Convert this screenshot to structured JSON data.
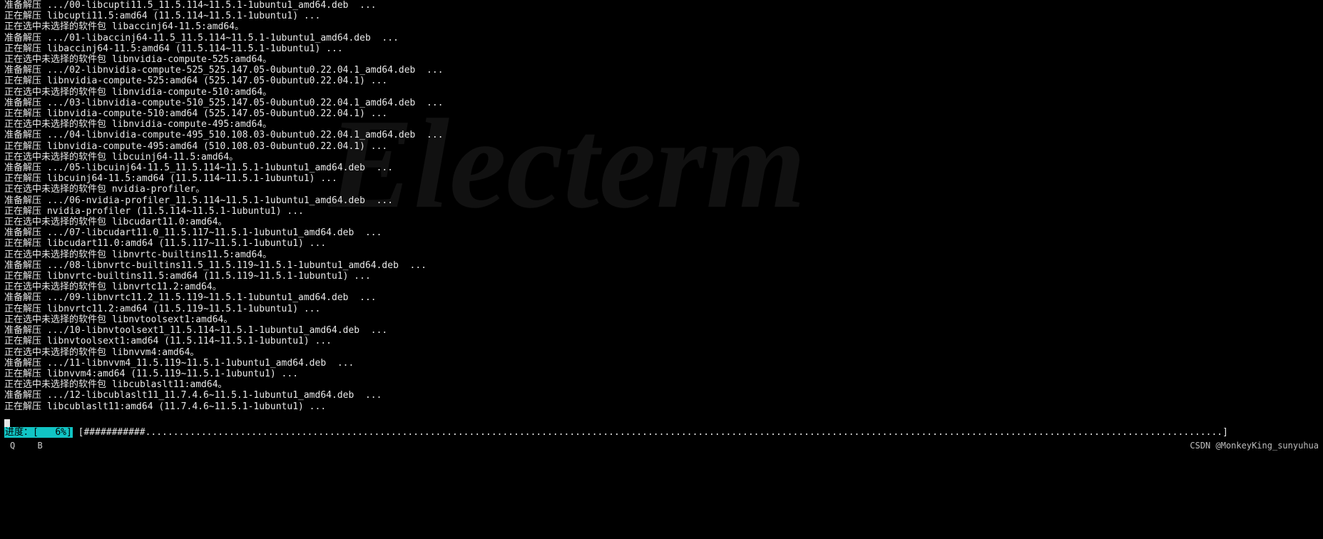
{
  "terminal": {
    "lines": [
      "准备解压 .../00-libcupti11.5_11.5.114~11.5.1-1ubuntu1_amd64.deb  ...",
      "正在解压 libcupti11.5:amd64 (11.5.114~11.5.1-1ubuntu1) ...",
      "正在选中未选择的软件包 libaccinj64-11.5:amd64。",
      "准备解压 .../01-libaccinj64-11.5_11.5.114~11.5.1-1ubuntu1_amd64.deb  ...",
      "正在解压 libaccinj64-11.5:amd64 (11.5.114~11.5.1-1ubuntu1) ...",
      "正在选中未选择的软件包 libnvidia-compute-525:amd64。",
      "准备解压 .../02-libnvidia-compute-525_525.147.05-0ubuntu0.22.04.1_amd64.deb  ...",
      "正在解压 libnvidia-compute-525:amd64 (525.147.05-0ubuntu0.22.04.1) ...",
      "正在选中未选择的软件包 libnvidia-compute-510:amd64。",
      "准备解压 .../03-libnvidia-compute-510_525.147.05-0ubuntu0.22.04.1_amd64.deb  ...",
      "正在解压 libnvidia-compute-510:amd64 (525.147.05-0ubuntu0.22.04.1) ...",
      "正在选中未选择的软件包 libnvidia-compute-495:amd64。",
      "准备解压 .../04-libnvidia-compute-495_510.108.03-0ubuntu0.22.04.1_amd64.deb  ...",
      "正在解压 libnvidia-compute-495:amd64 (510.108.03-0ubuntu0.22.04.1) ...",
      "正在选中未选择的软件包 libcuinj64-11.5:amd64。",
      "准备解压 .../05-libcuinj64-11.5_11.5.114~11.5.1-1ubuntu1_amd64.deb  ...",
      "正在解压 libcuinj64-11.5:amd64 (11.5.114~11.5.1-1ubuntu1) ...",
      "正在选中未选择的软件包 nvidia-profiler。",
      "准备解压 .../06-nvidia-profiler_11.5.114~11.5.1-1ubuntu1_amd64.deb  ...",
      "正在解压 nvidia-profiler (11.5.114~11.5.1-1ubuntu1) ...",
      "正在选中未选择的软件包 libcudart11.0:amd64。",
      "准备解压 .../07-libcudart11.0_11.5.117~11.5.1-1ubuntu1_amd64.deb  ...",
      "正在解压 libcudart11.0:amd64 (11.5.117~11.5.1-1ubuntu1) ...",
      "正在选中未选择的软件包 libnvrtc-builtins11.5:amd64。",
      "准备解压 .../08-libnvrtc-builtins11.5_11.5.119~11.5.1-1ubuntu1_amd64.deb  ...",
      "正在解压 libnvrtc-builtins11.5:amd64 (11.5.119~11.5.1-1ubuntu1) ...",
      "正在选中未选择的软件包 libnvrtc11.2:amd64。",
      "准备解压 .../09-libnvrtc11.2_11.5.119~11.5.1-1ubuntu1_amd64.deb  ...",
      "正在解压 libnvrtc11.2:amd64 (11.5.119~11.5.1-1ubuntu1) ...",
      "正在选中未选择的软件包 libnvtoolsext1:amd64。",
      "准备解压 .../10-libnvtoolsext1_11.5.114~11.5.1-1ubuntu1_amd64.deb  ...",
      "正在解压 libnvtoolsext1:amd64 (11.5.114~11.5.1-1ubuntu1) ...",
      "正在选中未选择的软件包 libnvvm4:amd64。",
      "准备解压 .../11-libnvvm4_11.5.119~11.5.1-1ubuntu1_amd64.deb  ...",
      "正在解压 libnvvm4:amd64 (11.5.119~11.5.1-1ubuntu1) ...",
      "正在选中未选择的软件包 libcublaslt11:amd64。",
      "准备解压 .../12-libcublaslt11_11.7.4.6~11.5.1-1ubuntu1_amd64.deb  ...",
      "正在解压 libcublaslt11:amd64 (11.7.4.6~11.5.1-1ubuntu1) ..."
    ]
  },
  "progress": {
    "label": "进度：",
    "percent_text": "[   6%]",
    "bar_fill": "###########",
    "bar_rest": ".................................................................................................................................................................................................]"
  },
  "bottom": {
    "key_q": "Q",
    "key_b": "B"
  },
  "attribution": "CSDN @MonkeyKing_sunyuhua",
  "watermark": "Electerm"
}
